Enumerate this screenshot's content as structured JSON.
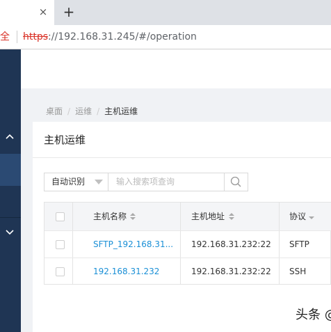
{
  "browser": {
    "tab_close": "×",
    "new_tab": "+",
    "security_label": "全",
    "url_scheme": "https",
    "url_rest": "://192.168.31.245/#/operation"
  },
  "breadcrumb": {
    "items": [
      "桌面",
      "运维",
      "主机运维"
    ],
    "separator": "/"
  },
  "page": {
    "title": "主机运维"
  },
  "filter": {
    "select_value": "自动识别",
    "search_placeholder": "输入搜索项查询"
  },
  "table": {
    "columns": [
      "主机名称",
      "主机地址",
      "协议"
    ],
    "rows": [
      {
        "name": "SFTP_192.168.31...",
        "address": "192.168.31.232:22",
        "protocol": "SFTP"
      },
      {
        "name": "192.168.31.232",
        "address": "192.168.31.232:22",
        "protocol": "SSH"
      }
    ]
  },
  "watermark": "头条 @",
  "colors": {
    "sidebar": "#1f3554",
    "link": "#1a8fd6",
    "insecure": "#d93025"
  }
}
